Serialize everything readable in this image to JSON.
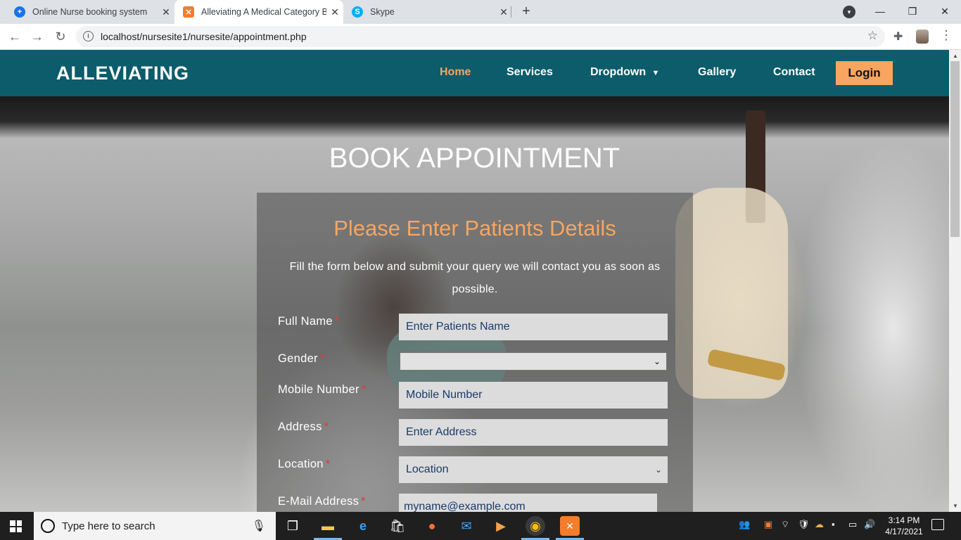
{
  "browser": {
    "tabs": [
      {
        "title": "Online Nurse booking system",
        "icon": "plus-circle-icon",
        "color": "#1a73e8"
      },
      {
        "title": "Alleviating A Medical Category B",
        "icon": "xampp-icon",
        "color": "#f57c2b"
      },
      {
        "title": "Skype",
        "icon": "skype-icon",
        "color": "#00aff0"
      }
    ],
    "url": "localhost/nursesite1/nursesite/appointment.php"
  },
  "site": {
    "brand": "ALLEVIATING",
    "nav": [
      {
        "label": "Home",
        "active": true
      },
      {
        "label": "Services"
      },
      {
        "label": "Dropdown"
      },
      {
        "label": "Gallery"
      },
      {
        "label": "Contact"
      }
    ],
    "login_label": "Login",
    "accent_color": "#f7a561",
    "nav_color": "#0c5c6b"
  },
  "page": {
    "title": "BOOK APPOINTMENT",
    "form_heading": "Please Enter Patients Details",
    "form_desc": "Fill the form below and submit your query we will contact you as soon as possible.",
    "fields": {
      "full_name": {
        "label": "Full Name",
        "placeholder": "Enter Patients Name"
      },
      "gender": {
        "label": "Gender",
        "value": ""
      },
      "mobile": {
        "label": "Mobile Number",
        "placeholder": "Mobile Number"
      },
      "address": {
        "label": "Address",
        "placeholder": "Enter Address"
      },
      "location": {
        "label": "Location",
        "value": "Location"
      },
      "email": {
        "label": "E-Mail Address",
        "placeholder": "myname@example.com"
      }
    },
    "required_marker": "*"
  },
  "taskbar": {
    "search_placeholder": "Type here to search",
    "time": "3:14 PM",
    "date": "4/17/2021"
  }
}
